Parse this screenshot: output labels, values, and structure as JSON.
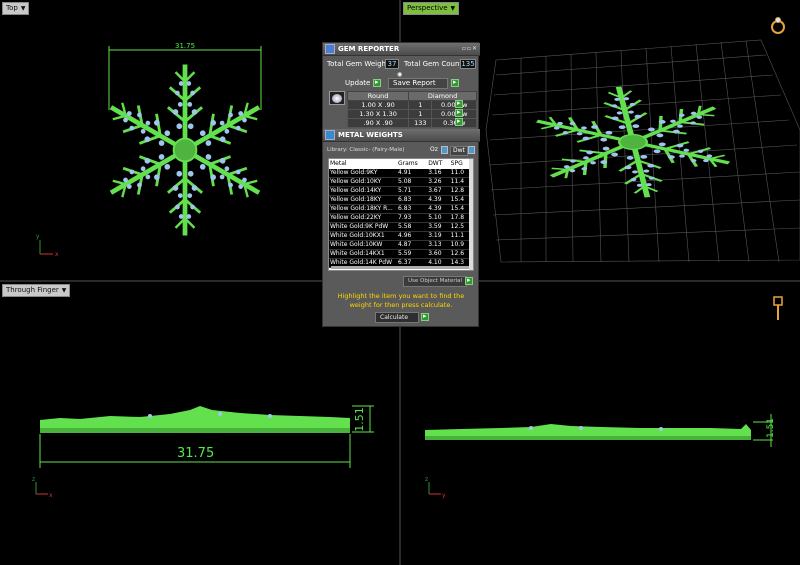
{
  "viewports": {
    "top": {
      "label": "Top",
      "dimension": "31.75"
    },
    "perspective": {
      "label": "Perspective"
    },
    "front": {
      "label": "Through Finger",
      "dimension_width": "31.75",
      "dimension_height": "1.51"
    },
    "right": {
      "dimension_height": "1.51"
    }
  },
  "gem_reporter": {
    "title": "GEM REPORTER",
    "total_gem_weight_label": "Total Gem Weight",
    "total_gem_weight": "37",
    "total_gem_count_label": "Total Gem Count",
    "total_gem_count": "135",
    "update_label": "Update",
    "save_report_label": "Save Report",
    "table_headers": [
      "Round",
      "Diamond"
    ],
    "rows": [
      {
        "size": "1.00 X .90",
        "count": "1",
        "weight": "0.003tw"
      },
      {
        "size": "1.30 X 1.30",
        "count": "1",
        "weight": "0.008tw"
      },
      {
        "size": ".90 X .90",
        "count": "133",
        "weight": "0.36tw"
      }
    ]
  },
  "metal_weights": {
    "title": "METAL WEIGHTS",
    "library_label": "Library: Classic- (Fairy-Male)",
    "oz_label": "Oz",
    "dwt_toggle_label": "Dwt",
    "columns": [
      "Metal",
      "Grams",
      "DWT",
      "SPG"
    ],
    "rows": [
      {
        "metal": "Yellow Gold:9KY",
        "grams": "4.91",
        "dwt": "3.16",
        "spg": "11.0"
      },
      {
        "metal": "Yellow Gold:10KY",
        "grams": "5.08",
        "dwt": "3.26",
        "spg": "11.4"
      },
      {
        "metal": "Yellow Gold:14KY",
        "grams": "5.71",
        "dwt": "3.67",
        "spg": "12.8"
      },
      {
        "metal": "Yellow Gold:18KY",
        "grams": "6.83",
        "dwt": "4.39",
        "spg": "15.4"
      },
      {
        "metal": "Yellow Gold:18KY R...",
        "grams": "6.83",
        "dwt": "4.39",
        "spg": "15.4"
      },
      {
        "metal": "Yellow Gold:22KY",
        "grams": "7.93",
        "dwt": "5.10",
        "spg": "17.8"
      },
      {
        "metal": "White Gold:9K PdW",
        "grams": "5.58",
        "dwt": "3.59",
        "spg": "12.5"
      },
      {
        "metal": "White Gold:10KX1",
        "grams": "4.96",
        "dwt": "3.19",
        "spg": "11.1"
      },
      {
        "metal": "White Gold:10KW",
        "grams": "4.87",
        "dwt": "3.13",
        "spg": "10.9"
      },
      {
        "metal": "White Gold:14KX1",
        "grams": "5.59",
        "dwt": "3.60",
        "spg": "12.6"
      },
      {
        "metal": "White Gold:14K PdW",
        "grams": "6.37",
        "dwt": "4.10",
        "spg": "14.3"
      }
    ],
    "use_object_material_label": "Use Object Material",
    "hint": "Highlight the item you want to find the weight for then press calculate.",
    "calculate_label": "Calculate"
  },
  "colors": {
    "model_green": "#63e04e",
    "gem_blue": "#9fc6ea",
    "hint_yellow": "#ffd800"
  }
}
